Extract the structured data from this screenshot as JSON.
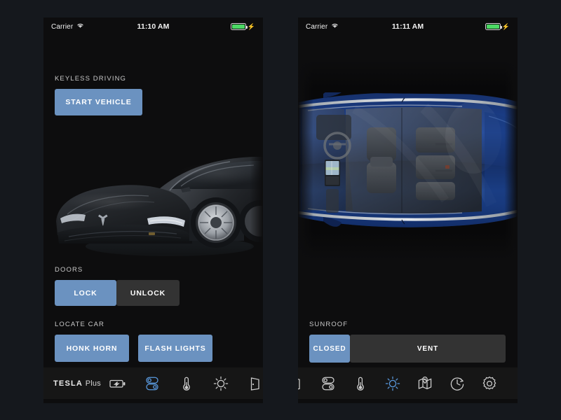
{
  "colors": {
    "page_background": "#15181d",
    "screen_background": "#0d0d0e",
    "accent_blue": "#6b92c0",
    "tab_active_blue": "#5a9ae0",
    "segment_inactive": "#333333",
    "battery_green": "#4cd964",
    "label_text": "#c9c9c9"
  },
  "phones": [
    {
      "id": "left",
      "status_bar": {
        "carrier": "Carrier",
        "wifi_icon": "wifi-icon",
        "time": "11:10 AM",
        "battery_icon": "battery-icon",
        "charging_icon": "lightning-bolt-icon"
      },
      "hero": {
        "name": "tesla-model-s-front-image",
        "description": "Dark grey Tesla Model S front three-quarter view"
      },
      "sections": [
        {
          "label": "KEYLESS DRIVING",
          "buttons": [
            {
              "label": "START VEHICLE",
              "style": "primary"
            }
          ]
        },
        {
          "label": "DOORS",
          "segments": [
            {
              "label": "LOCK",
              "active": true
            },
            {
              "label": "UNLOCK",
              "active": false
            }
          ]
        },
        {
          "label": "LOCATE CAR",
          "buttons": [
            {
              "label": "HONK HORN",
              "style": "primary"
            },
            {
              "label": "FLASH LIGHTS",
              "style": "primary"
            }
          ]
        }
      ],
      "tabbar": {
        "brand_primary": "TESLA",
        "brand_secondary": "Plus",
        "tabs": [
          {
            "icon": "battery-charging-icon",
            "active": false
          },
          {
            "icon": "toggles-icon",
            "active": true
          },
          {
            "icon": "thermometer-icon",
            "active": false
          },
          {
            "icon": "sun-icon",
            "active": false
          },
          {
            "icon": "door-icon",
            "active": false
          }
        ]
      }
    },
    {
      "id": "right",
      "status_bar": {
        "carrier": "Carrier",
        "wifi_icon": "wifi-icon",
        "time": "11:11 AM",
        "battery_icon": "battery-icon",
        "charging_icon": "lightning-bolt-icon"
      },
      "hero": {
        "name": "tesla-model-s-roof-image",
        "description": "Blue Tesla Model S viewed from above through glass roof"
      },
      "sections": [
        {
          "label": "SUNROOF",
          "segments": [
            {
              "label": "CLOSED",
              "active": true
            },
            {
              "label": "VENT",
              "active": false
            }
          ]
        }
      ],
      "tabbar": {
        "tabs": [
          {
            "icon": "door-icon",
            "active": false
          },
          {
            "icon": "toggles-icon",
            "active": false
          },
          {
            "icon": "thermometer-icon",
            "active": false
          },
          {
            "icon": "sun-icon",
            "active": true
          },
          {
            "icon": "map-pin-icon",
            "active": false
          },
          {
            "icon": "clock-timer-icon",
            "active": false
          },
          {
            "icon": "gear-icon",
            "active": false
          }
        ]
      }
    }
  ]
}
